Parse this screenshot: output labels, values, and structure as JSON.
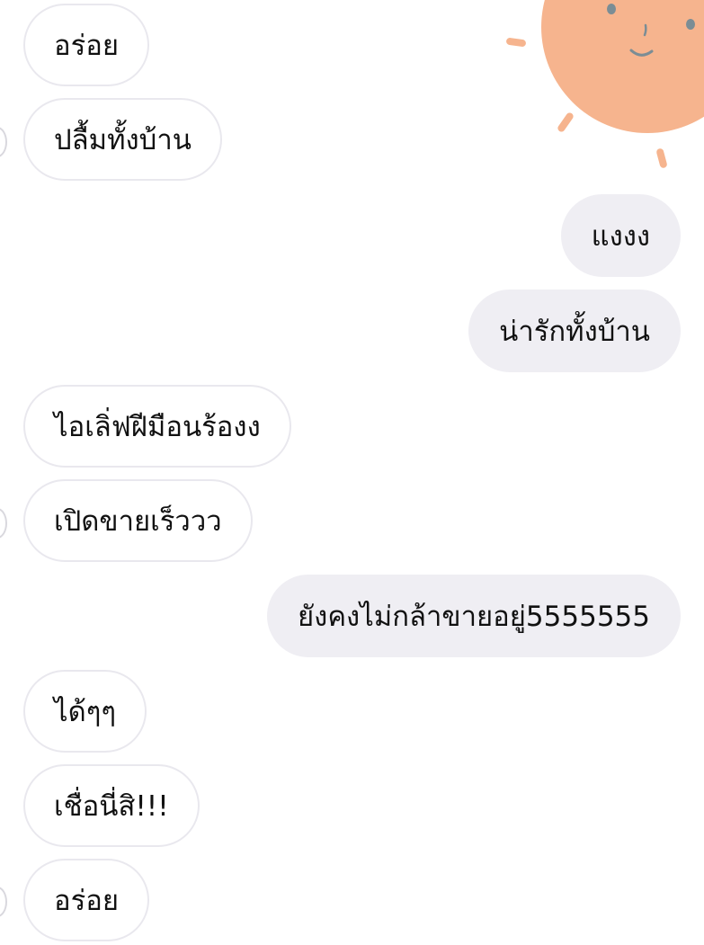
{
  "messages": [
    {
      "side": "in",
      "text": "อร่อย"
    },
    {
      "side": "in",
      "text": "ปลื้มทั้งบ้าน"
    },
    {
      "side": "out",
      "text": "แงงง"
    },
    {
      "side": "out",
      "text": "น่ารักทั้งบ้าน"
    },
    {
      "side": "in",
      "text": "ไอเลิ่ฟฝีมือนร้องง"
    },
    {
      "side": "in",
      "text": "เปิดขายเร็ววว"
    },
    {
      "side": "out",
      "text": "ยังคงไม่กล้าขายอยู่5555555"
    },
    {
      "side": "in",
      "text": "ได้ๆๆ"
    },
    {
      "side": "in",
      "text": "เชื่อนี่สิ!!!"
    },
    {
      "side": "in",
      "text": "อร่อย"
    }
  ],
  "sticker": {
    "icon": "sun-sticker-icon",
    "color": "#f6b48e",
    "face_color": "#7b8d95"
  },
  "colors": {
    "incoming_bg": "#ffffff",
    "incoming_border": "#e9e8ee",
    "outgoing_bg": "#efeef3",
    "text": "#111111"
  }
}
